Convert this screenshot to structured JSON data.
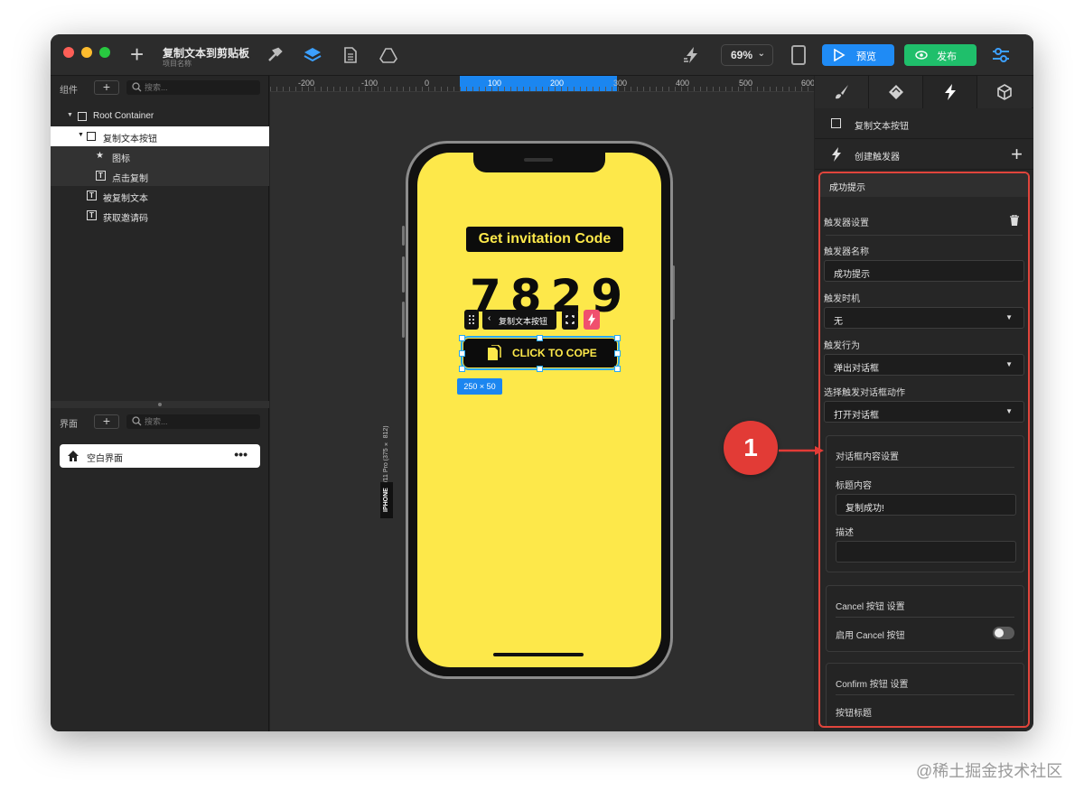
{
  "titlebar": {
    "project_title": "复制文本到剪贴板",
    "project_subtitle": "项目名称",
    "zoom": "69%",
    "preview_label": "预览",
    "publish_label": "发布"
  },
  "left_panel": {
    "components_label": "组件",
    "add_label": "+",
    "search_placeholder": "搜索...",
    "tree": [
      {
        "label": "Root Container"
      },
      {
        "label": "复制文本按钮"
      },
      {
        "label": "图标"
      },
      {
        "label": "点击复制"
      },
      {
        "label": "被复制文本"
      },
      {
        "label": "获取邀请码"
      }
    ],
    "screens_label": "界面",
    "screens_search_placeholder": "搜索...",
    "screen_item": "空白界面",
    "screen_more": "•••"
  },
  "canvas": {
    "ruler_ticks": [
      "-200",
      "-100",
      "0",
      "100",
      "200",
      "300",
      "400",
      "500",
      "600"
    ],
    "device_name": "iPhone X/XS/11 Pro (375 × 812)",
    "device_tag": "IPHONE",
    "invite_title": "Get invitation Code",
    "code": "7829",
    "floating_toolbar_label": "复制文本按钮",
    "button_label": "CLICK TO COPE",
    "size_tag": "250 × 50"
  },
  "right_panel": {
    "selected_element": "复制文本按钮",
    "create_trigger": "创建触发器",
    "trigger_name_header": "成功提示",
    "trigger_settings": "触发器设置",
    "trigger_name_label": "触发器名称",
    "trigger_name_value": "成功提示",
    "trigger_timing_label": "触发时机",
    "trigger_timing_value": "无",
    "trigger_action_label": "触发行为",
    "trigger_action_value": "弹出对话框",
    "dialog_action_label": "选择触发对话框动作",
    "dialog_action_value": "打开对话框",
    "dialog_content_settings": "对话框内容设置",
    "title_content_label": "标题内容",
    "title_content_value": "复制成功!",
    "description_label": "描述",
    "description_value": "",
    "cancel_settings": "Cancel 按钮 设置",
    "enable_cancel": "启用 Cancel 按钮",
    "enable_cancel_on": false,
    "confirm_settings": "Confirm 按钮 设置",
    "button_title_label": "按钮标题"
  },
  "annotation": {
    "badge": "1"
  },
  "watermark": "@稀土掘金技术社区",
  "colors": {
    "accent_blue": "#1f8bf5",
    "publish_green": "#1fbf6b",
    "phone_yellow": "#fde84a",
    "highlight_red": "#e0453c"
  }
}
